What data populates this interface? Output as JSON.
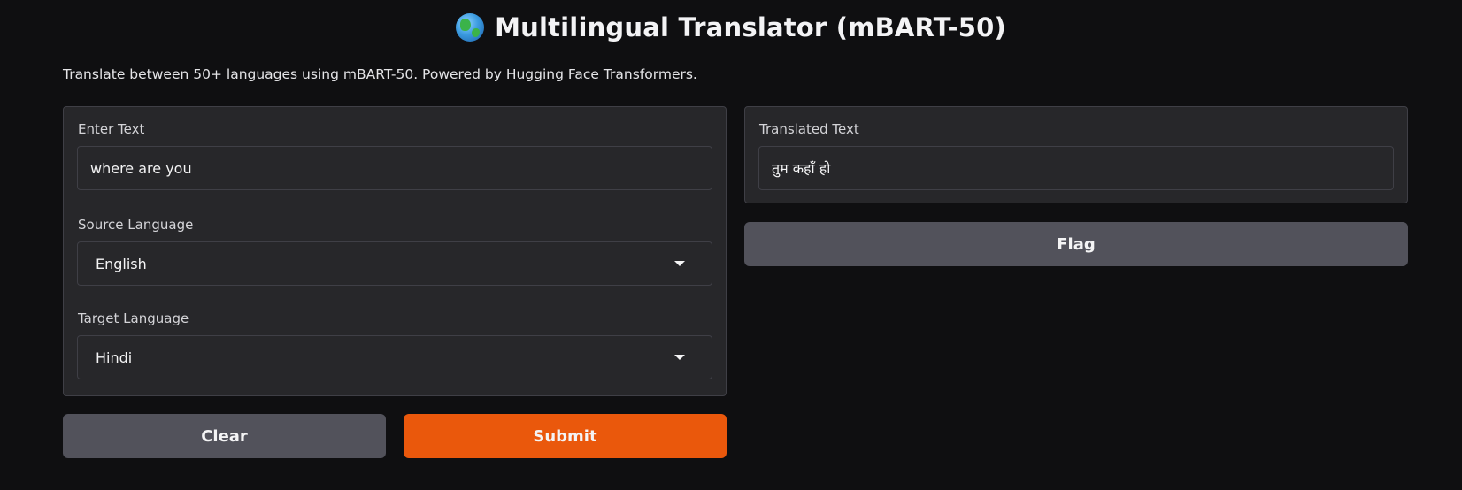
{
  "header": {
    "icon": "globe-icon",
    "title": "Multilingual Translator (mBART-50)",
    "description": "Translate between 50+ languages using mBART-50. Powered by Hugging Face Transformers."
  },
  "inputs": {
    "text_label": "Enter Text",
    "text_value": "where are you",
    "source_label": "Source Language",
    "source_value": "English",
    "target_label": "Target Language",
    "target_value": "Hindi"
  },
  "output": {
    "label": "Translated Text",
    "value": "तुम कहाँ हो"
  },
  "buttons": {
    "clear": "Clear",
    "submit": "Submit",
    "flag": "Flag"
  },
  "colors": {
    "background": "#0f0f11",
    "panel": "#27272a",
    "border": "#3f3f46",
    "secondary_button": "#52525b",
    "primary_button": "#ea580c"
  }
}
